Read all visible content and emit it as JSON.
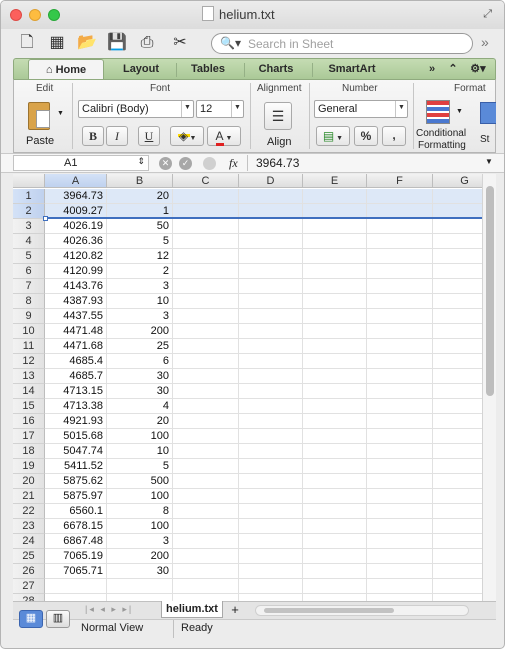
{
  "window": {
    "title": "helium.txt"
  },
  "toolbar": {
    "search_placeholder": "Search in Sheet"
  },
  "ribbon_tabs": [
    "Home",
    "Layout",
    "Tables",
    "Charts",
    "SmartArt"
  ],
  "ribbon": {
    "edit_label": "Edit",
    "paste_label": "Paste",
    "font_label": "Font",
    "font_name": "Calibri (Body)",
    "font_size": "12",
    "bold": "B",
    "italic": "I",
    "underline": "U",
    "font_color_letter": "A",
    "alignment_label": "Alignment",
    "align_label": "Align",
    "number_label": "Number",
    "number_format": "General",
    "percent": "%",
    "comma": ",",
    "format_label": "Format",
    "conditional_label_1": "Conditional",
    "conditional_label_2": "Formatting",
    "styles_partial": "St"
  },
  "formula_bar": {
    "cell_ref": "A1",
    "fx": "fx",
    "value": "3964.73"
  },
  "columns": [
    "A",
    "B",
    "C",
    "D",
    "E",
    "F",
    "G"
  ],
  "rows": [
    [
      "3964.73",
      "20"
    ],
    [
      "4009.27",
      "1"
    ],
    [
      "4026.19",
      "50"
    ],
    [
      "4026.36",
      "5"
    ],
    [
      "4120.82",
      "12"
    ],
    [
      "4120.99",
      "2"
    ],
    [
      "4143.76",
      "3"
    ],
    [
      "4387.93",
      "10"
    ],
    [
      "4437.55",
      "3"
    ],
    [
      "4471.48",
      "200"
    ],
    [
      "4471.68",
      "25"
    ],
    [
      "4685.4",
      "6"
    ],
    [
      "4685.7",
      "30"
    ],
    [
      "4713.15",
      "30"
    ],
    [
      "4713.38",
      "4"
    ],
    [
      "4921.93",
      "20"
    ],
    [
      "5015.68",
      "100"
    ],
    [
      "5047.74",
      "10"
    ],
    [
      "5411.52",
      "5"
    ],
    [
      "5875.62",
      "500"
    ],
    [
      "5875.97",
      "100"
    ],
    [
      "6560.1",
      "8"
    ],
    [
      "6678.15",
      "100"
    ],
    [
      "6867.48",
      "3"
    ],
    [
      "7065.19",
      "200"
    ],
    [
      "7065.71",
      "30"
    ],
    [
      "",
      ""
    ],
    [
      "",
      ""
    ]
  ],
  "sheet": {
    "tab": "helium.txt",
    "add": "+"
  },
  "status": {
    "view": "Normal View",
    "state": "Ready"
  },
  "colors": {
    "tab_green": "#a9c896",
    "selection": "#dde8f7",
    "selection_border": "#3f6fbf"
  }
}
